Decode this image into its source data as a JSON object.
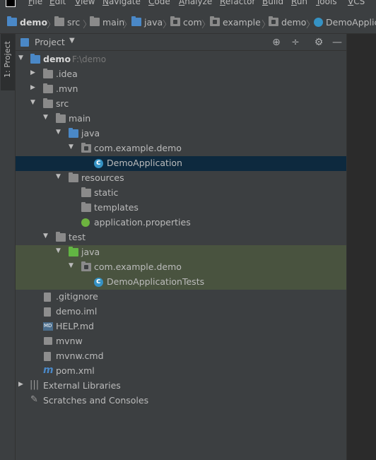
{
  "menubar": {
    "items": [
      "File",
      "Edit",
      "View",
      "Navigate",
      "Code",
      "Analyze",
      "Refactor",
      "Build",
      "Run",
      "Tools",
      "VCS"
    ]
  },
  "breadcrumb": [
    "demo",
    "src",
    "main",
    "java",
    "com",
    "example",
    "demo",
    "DemoApplic"
  ],
  "side_tab": {
    "label": "1: Project"
  },
  "panel": {
    "title": "Project"
  },
  "tree": [
    {
      "label": "demo",
      "path": "F:\\demo",
      "icon": "module-folder-icon",
      "expanded": true
    },
    {
      "label": ".idea",
      "icon": "folder-icon",
      "expanded": false
    },
    {
      "label": ".mvn",
      "icon": "folder-icon",
      "expanded": false
    },
    {
      "label": "src",
      "icon": "folder-icon",
      "expanded": true
    },
    {
      "label": "main",
      "icon": "folder-icon",
      "expanded": true
    },
    {
      "label": "java",
      "icon": "source-folder-icon",
      "expanded": true
    },
    {
      "label": "com.example.demo",
      "icon": "package-icon",
      "expanded": true
    },
    {
      "label": "DemoApplication",
      "icon": "spring-boot-class-icon",
      "selected": true
    },
    {
      "label": "resources",
      "icon": "resources-folder-icon",
      "expanded": true
    },
    {
      "label": "static",
      "icon": "folder-icon"
    },
    {
      "label": "templates",
      "icon": "folder-icon"
    },
    {
      "label": "application.properties",
      "icon": "spring-properties-icon"
    },
    {
      "label": "test",
      "icon": "folder-icon",
      "expanded": true
    },
    {
      "label": "java",
      "icon": "test-source-folder-icon",
      "expanded": true
    },
    {
      "label": "com.example.demo",
      "icon": "package-icon",
      "expanded": true
    },
    {
      "label": "DemoApplicationTests",
      "icon": "test-class-icon"
    },
    {
      "label": ".gitignore",
      "icon": "gitignore-file-icon"
    },
    {
      "label": "demo.iml",
      "icon": "iml-file-icon"
    },
    {
      "label": "HELP.md",
      "icon": "markdown-file-icon"
    },
    {
      "label": "mvnw",
      "icon": "script-file-icon"
    },
    {
      "label": "mvnw.cmd",
      "icon": "cmd-file-icon"
    },
    {
      "label": "pom.xml",
      "icon": "maven-file-icon"
    },
    {
      "label": "External Libraries",
      "icon": "libraries-icon",
      "expanded": false
    },
    {
      "label": "Scratches and Consoles",
      "icon": "scratches-icon"
    }
  ],
  "colors": {
    "selection": "#0d293e",
    "test_highlight": "#49533f",
    "panel_bg": "#3c3f41",
    "editor_bg": "#2b2b2b"
  }
}
